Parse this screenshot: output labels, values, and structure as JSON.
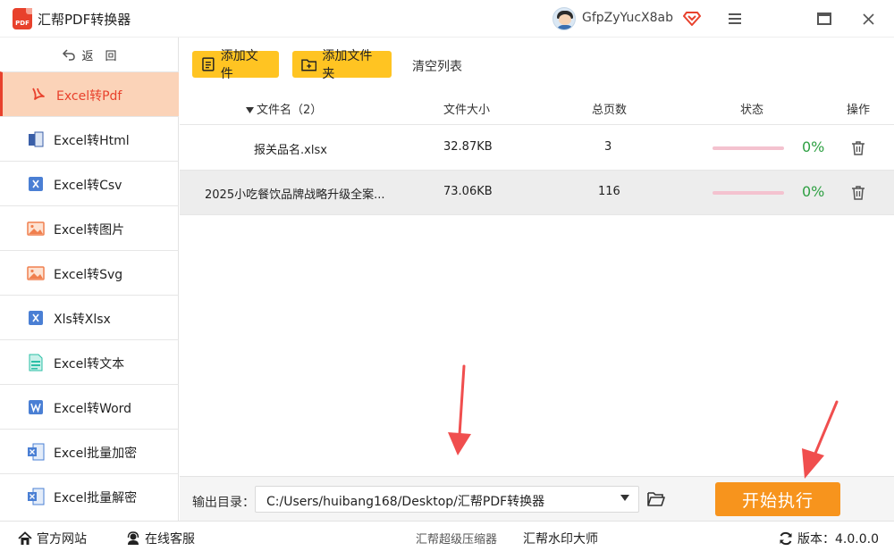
{
  "app": {
    "title": "汇帮PDF转换器",
    "logo_text": "PDF"
  },
  "user": {
    "name": "GfpZyYucX8ab"
  },
  "sidebar": {
    "back_label": "返　回",
    "items": [
      {
        "label": "Excel转Pdf",
        "icon": "pdf-icon",
        "active": true
      },
      {
        "label": "Excel转Html",
        "icon": "html-icon"
      },
      {
        "label": "Excel转Csv",
        "icon": "excel-x-icon"
      },
      {
        "label": "Excel转图片",
        "icon": "image-icon"
      },
      {
        "label": "Excel转Svg",
        "icon": "image-icon"
      },
      {
        "label": "Xls转Xlsx",
        "icon": "excel-x-icon"
      },
      {
        "label": "Excel转文本",
        "icon": "text-doc-icon"
      },
      {
        "label": "Excel转Word",
        "icon": "word-icon"
      },
      {
        "label": "Excel批量加密",
        "icon": "excel-doc-icon"
      },
      {
        "label": "Excel批量解密",
        "icon": "excel-doc-icon"
      }
    ]
  },
  "toolbar": {
    "add_file": "添加文件",
    "add_folder": "添加文件夹",
    "clear_list": "清空列表"
  },
  "table": {
    "headers": {
      "name": "文件名（2）",
      "size": "文件大小",
      "pages": "总页数",
      "status": "状态",
      "action": "操作"
    },
    "rows": [
      {
        "name": "报关品名.xlsx",
        "size": "32.87KB",
        "pages": "3",
        "progress": "0%"
      },
      {
        "name": "2025小吃餐饮品牌战略升级全案...",
        "size": "73.06KB",
        "pages": "116",
        "progress": "0%"
      }
    ]
  },
  "output": {
    "label": "输出目录：",
    "path": "C:/Users/huibang168/Desktop/汇帮PDF转换器",
    "start_label": "开始执行"
  },
  "footer": {
    "website": "官方网站",
    "support": "在线客服",
    "compressor": "汇帮超级压缩器",
    "watermark_tool": "汇帮水印大师",
    "version": "版本：4.0.0.0"
  },
  "colors": {
    "accent": "#e8412c",
    "toolbar_button": "#ffc422",
    "start_button": "#f7941d",
    "active_nav_bg": "#fbd3b8",
    "progress_text": "#2ea043",
    "annotation_arrow": "#f04e4e"
  }
}
